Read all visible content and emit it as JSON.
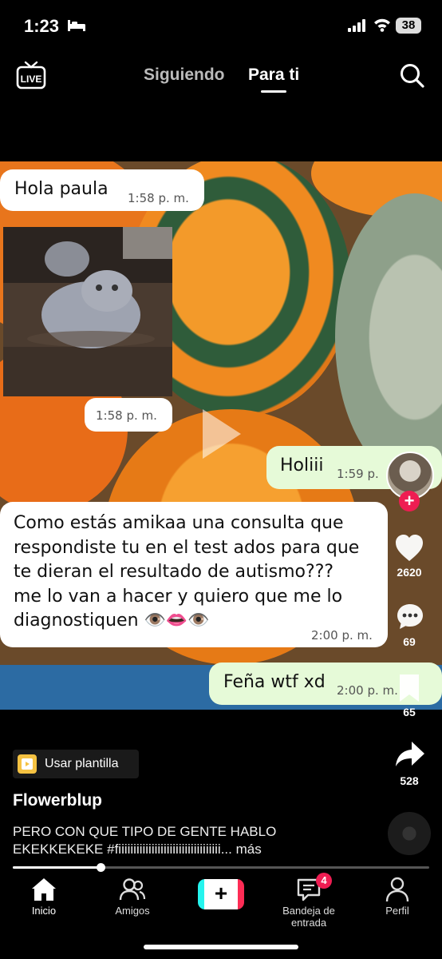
{
  "status_bar": {
    "time": "1:23",
    "battery": "38"
  },
  "top_nav": {
    "following": "Siguiendo",
    "for_you": "Para ti",
    "live_label": "LIVE"
  },
  "chat": {
    "msg1": {
      "text": "Hola paula",
      "time": "1:58 p. m."
    },
    "msg2": {
      "time": "1:58 p. m."
    },
    "msg3": {
      "text": "Holiii",
      "time": "1:59 p."
    },
    "msg4": {
      "lines": [
        "Como estás amikaa una consulta que",
        "respondiste tu en el test ados para que",
        "te dieran el resultado de autismo???",
        "me lo van a hacer y quiero que me lo",
        "diagnostiquen 👁️👄👁️"
      ],
      "time": "2:00 p. m."
    },
    "msg5": {
      "text": "Feña wtf xd",
      "time": "2:00 p. m."
    }
  },
  "actions": {
    "likes": "2620",
    "comments": "69",
    "saves": "65",
    "shares": "528"
  },
  "post": {
    "template_label": "Usar plantilla",
    "username": "Flowerblup",
    "caption_line1": "PERO CON QUE TIPO DE GENTE HABLO",
    "caption_line2": "EKEKKEKEKE #fiiiiiiiiiiiiiiiiiiiiiiiiiiiiiiiiii... más",
    "progress": 0.21
  },
  "bottom_nav": {
    "home": "Inicio",
    "friends": "Amigos",
    "inbox": "Bandeja de entrada",
    "inbox_badge": "4",
    "profile": "Perfil"
  },
  "colors": {
    "accent_red": "#ee1d52",
    "outgoing_bubble": "#e6fad8",
    "create_cyan": "#25f4ee",
    "create_pink": "#fe2c55"
  }
}
